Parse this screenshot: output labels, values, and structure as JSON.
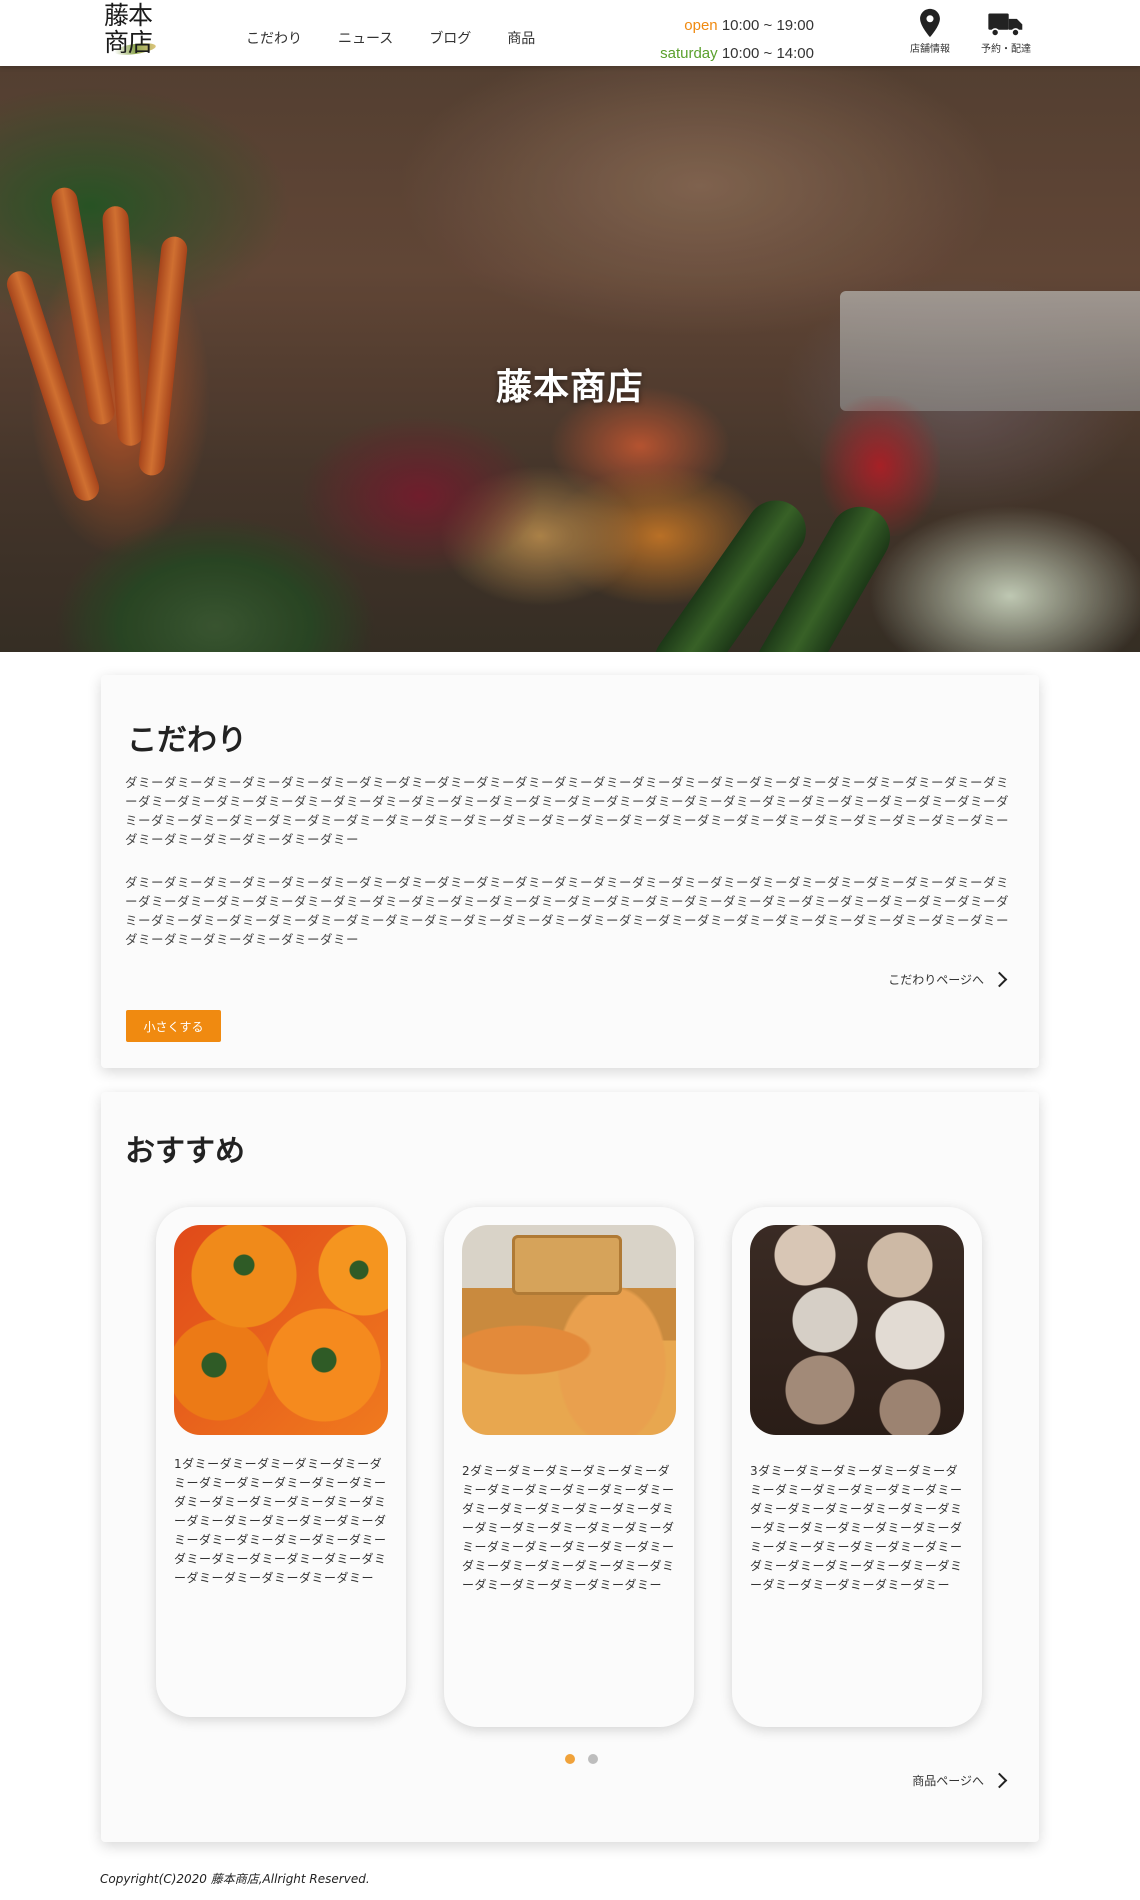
{
  "header": {
    "logo_text": "藤本商店",
    "nav": [
      "こだわり",
      "ニュース",
      "ブログ",
      "商品"
    ],
    "hours": {
      "open_label": "open",
      "open_time": "10:00 ~ 19:00",
      "saturday_label": "saturday",
      "saturday_time": "10:00 ~ 14:00"
    },
    "icons": {
      "store_label": "店舗情報",
      "delivery_label": "予約・配達"
    }
  },
  "hero": {
    "title": "藤本商店"
  },
  "kodawari": {
    "title": "こだわり",
    "paragraph_1": "ダミーダミーダミーダミーダミーダミーダミーダミーダミーダミーダミーダミーダミーダミーダミーダミーダミーダミーダミーダミーダミーダミーダミーダミーダミーダミーダミーダミーダミーダミーダミーダミーダミーダミーダミーダミーダミーダミーダミーダミーダミーダミーダミーダミーダミーダミーダミーダミーダミーダミーダミーダミーダミーダミーダミーダミーダミーダミーダミーダミーダミーダミーダミーダミーダミーダミーダミーダミーダミーダミーダミーダミーダミーダミー",
    "paragraph_2": "ダミーダミーダミーダミーダミーダミーダミーダミーダミーダミーダミーダミーダミーダミーダミーダミーダミーダミーダミーダミーダミーダミーダミーダミーダミーダミーダミーダミーダミーダミーダミーダミーダミーダミーダミーダミーダミーダミーダミーダミーダミーダミーダミーダミーダミーダミーダミーダミーダミーダミーダミーダミーダミーダミーダミーダミーダミーダミーダミーダミーダミーダミーダミーダミーダミーダミーダミーダミーダミーダミーダミーダミーダミーダミー",
    "page_link": "こだわりページへ",
    "shrink_button": "小さくする"
  },
  "osusume": {
    "title": "おすすめ",
    "products": [
      {
        "text": "1ダミーダミーダミーダミーダミーダミーダミーダミーダミーダミーダミーダミーダミーダミーダミーダミーダミーダミーダミーダミーダミーダミーダミーダミーダミーダミーダミーダミーダミーダミーダミーダミーダミーダミーダミーダミーダミーダミーダミー"
      },
      {
        "text": "2ダミーダミーダミーダミーダミーダミーダミーダミーダミーダミーダミーダミーダミーダミーダミーダミーダミーダミーダミーダミーダミーダミーダミーダミーダミーダミーダミーダミーダミーダミーダミーダミーダミーダミーダミーダミーダミーダミーダミー"
      },
      {
        "text": "3ダミーダミーダミーダミーダミーダミーダミーダミーダミーダミーダミーダミーダミーダミーダミーダミーダミーダミーダミーダミーダミーダミーダミーダミーダミーダミーダミーダミーダミーダミーダミーダミーダミーダミーダミーダミーダミーダミーダミー"
      }
    ],
    "page_link": "商品ページへ",
    "carousel": {
      "pages": 2,
      "active": 1
    }
  },
  "footer": {
    "copyright": "Copyright(C)2020 藤本商店,Allright Reserved."
  },
  "colors": {
    "accent_orange": "#f08a10",
    "saturday_green": "#5aa02c",
    "dot_active": "#f0a23a",
    "dot_inactive": "#bdbdbd"
  }
}
